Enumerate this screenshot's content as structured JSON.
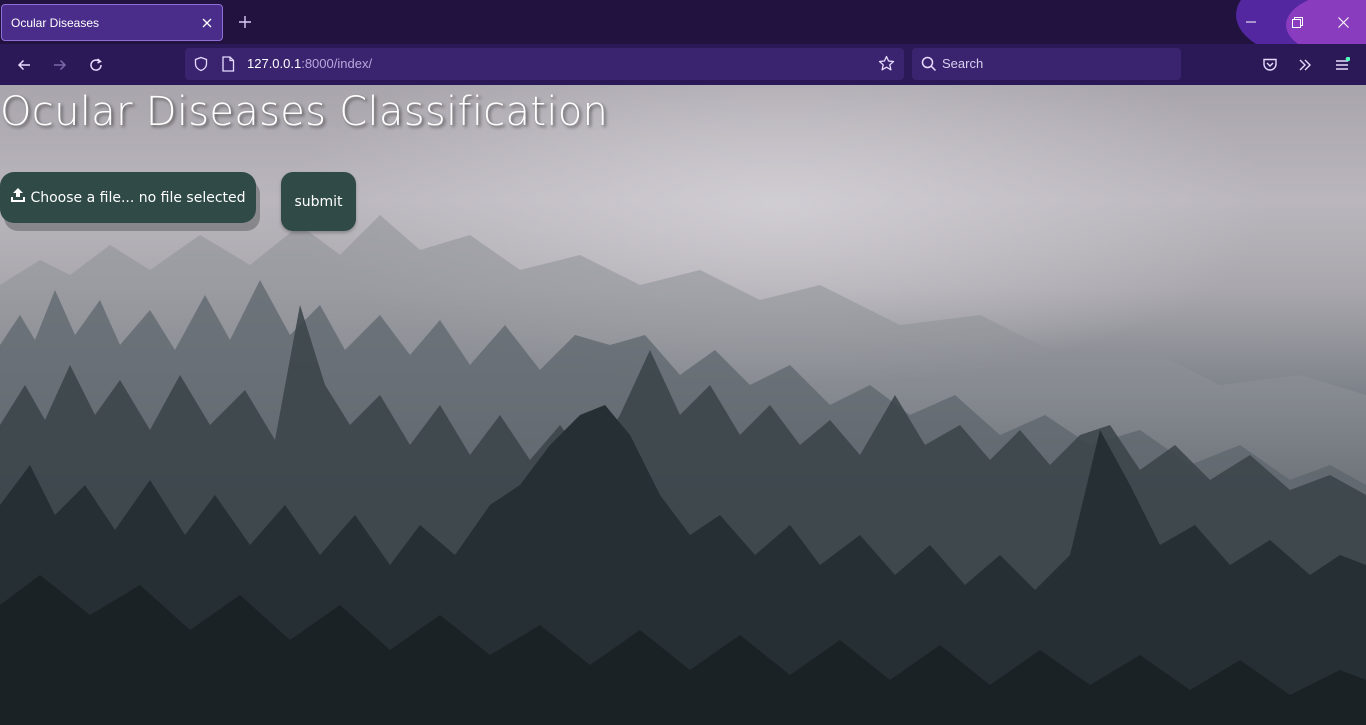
{
  "browser": {
    "tab_title": "Ocular Diseases",
    "url_host": "127.0.0.1",
    "url_path": ":8000/index/",
    "search_placeholder": "Search",
    "accent_color": "#2b1857"
  },
  "page": {
    "title": "Ocular Diseases Classification",
    "file_button_label": "Choose a file... no file selected",
    "submit_label": "submit",
    "button_color": "#2f4a47"
  }
}
